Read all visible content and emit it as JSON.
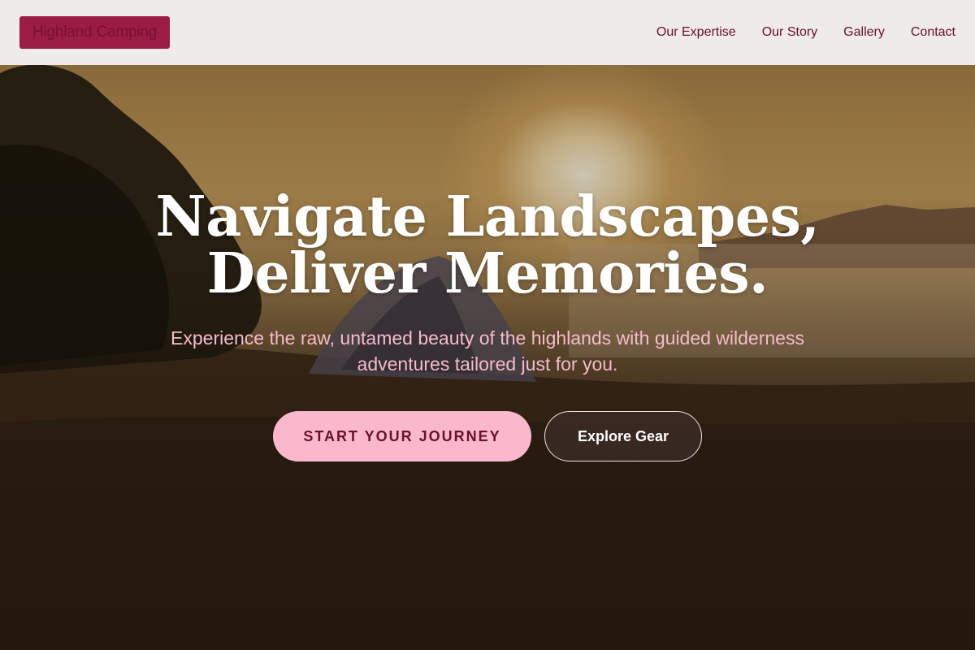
{
  "header": {
    "logo_text": "Highland Camping",
    "nav": [
      {
        "label": "Our Expertise"
      },
      {
        "label": "Our Story"
      },
      {
        "label": "Gallery"
      },
      {
        "label": "Contact"
      }
    ]
  },
  "hero": {
    "title_line1": "Navigate Landscapes,",
    "title_line2": "Deliver Memories.",
    "subtitle": "Experience the raw, untamed beauty of the highlands with guided wilderness adventures tailored just for you.",
    "primary_cta": "START YOUR JOURNEY",
    "secondary_cta": "Explore Gear",
    "background_image": "sunrise-camping-tent-hillside"
  },
  "colors": {
    "brand": "#9b1c44",
    "nav_text": "#6b0f2c",
    "primary_button_bg": "#f9b8cc",
    "subtitle_text": "#f4bccb"
  }
}
